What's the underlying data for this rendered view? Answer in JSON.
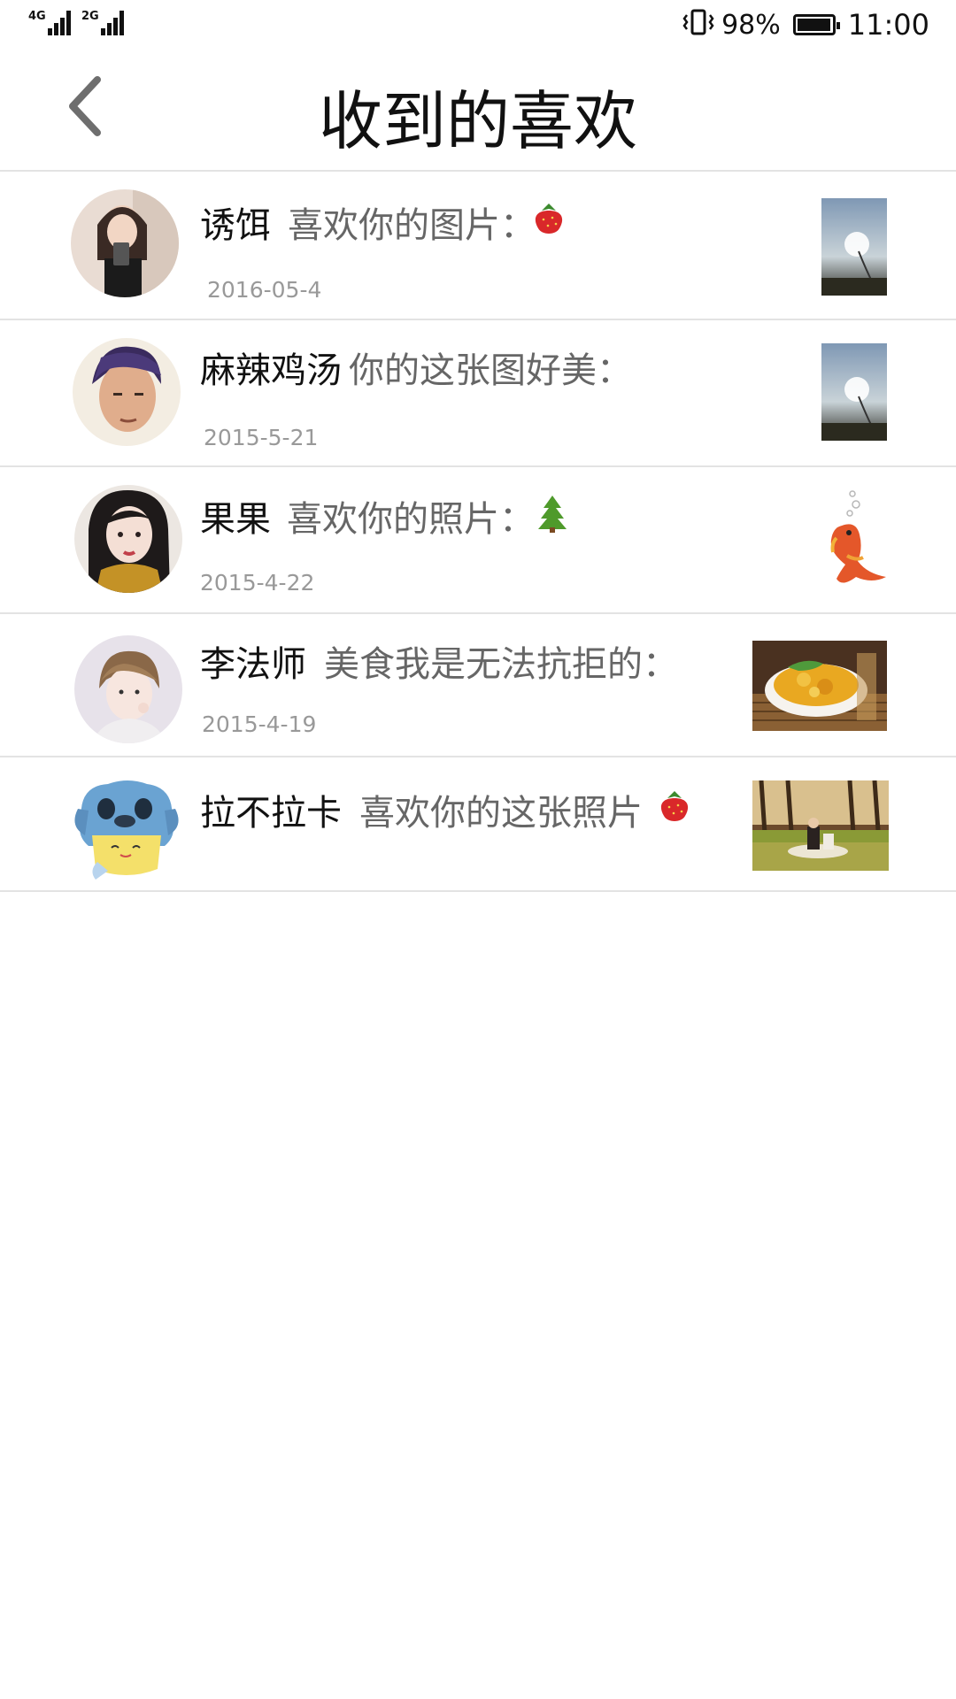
{
  "status_bar": {
    "network_1": "4G",
    "network_2": "2G",
    "battery_percent": "98%",
    "battery_level": 0.98,
    "time": "11:00"
  },
  "header": {
    "title": "收到的喜欢",
    "back_icon": "chevron-left-icon"
  },
  "likes": [
    {
      "user": "诱饵",
      "message": "喜欢你的图片：",
      "emoji": "strawberry",
      "date": "2016-05-4",
      "thumbnail": "dandelion-photo"
    },
    {
      "user": "麻辣鸡汤",
      "message": "你的这张图好美：",
      "emoji": "",
      "date": "2015-5-21",
      "thumbnail": "dandelion-photo"
    },
    {
      "user": "果果",
      "message": "喜欢你的照片：",
      "emoji": "tree",
      "date": "2015-4-22",
      "thumbnail": "koi-fish-illustration"
    },
    {
      "user": "李法师",
      "message": "美食我是无法抗拒的：",
      "emoji": "",
      "date": "2015-4-19",
      "thumbnail": "food-dish-photo"
    },
    {
      "user": "拉不拉卡",
      "message": "喜欢你的这张照片",
      "emoji": "strawberry",
      "date": "",
      "thumbnail": "forest-couple-photo"
    }
  ]
}
